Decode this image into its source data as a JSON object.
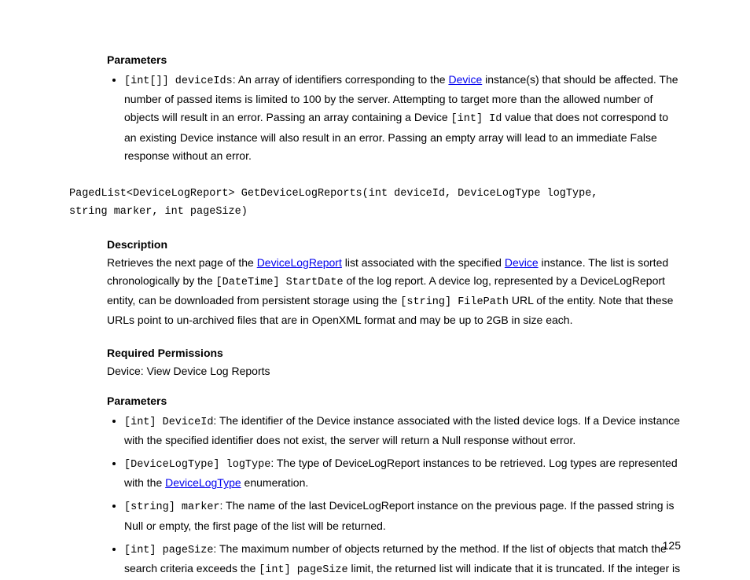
{
  "section1": {
    "heading": "Parameters",
    "bullet1_code": "[int[]] deviceIds",
    "bullet1_pre": ": An array of identifiers corresponding to the ",
    "bullet1_link": "Device",
    "bullet1_post": " instance(s) that should be affected. The number of passed items is limited to 100 by the server. Attempting to target more than the allowed number of objects will result in an error. Passing an array containing a Device ",
    "bullet1_code2": "[int] Id",
    "bullet1_tail": " value that does not correspond to an existing Device instance will also result in an error. Passing an empty array will lead to an immediate False response without an error."
  },
  "signature": {
    "line1": "PagedList<DeviceLogReport> GetDeviceLogReports(int deviceId, DeviceLogType logType,",
    "line2": "string marker, int pageSize)"
  },
  "description": {
    "heading": "Description",
    "t1": "Retrieves the next page of the ",
    "link1": "DeviceLogReport",
    "t2": " list associated with the specified ",
    "link2": "Device",
    "t3": " instance. The list is sorted chronologically by the ",
    "code1": "[DateTime] StartDate",
    "t4": " of the log report. A device log, represented by a DeviceLogReport entity, can be downloaded from persistent storage using the ",
    "code2": "[string] FilePath",
    "t5": " URL of the entity. Note that these URLs point to un-archived files that are in OpenXML format and may be up to 2GB in size each."
  },
  "permissions": {
    "heading": "Required Permissions",
    "text": "Device: View Device Log Reports"
  },
  "params2": {
    "heading": "Parameters",
    "b1_code": "[int] DeviceId",
    "b1_text": ": The identifier of the Device instance associated with the listed device logs. If a Device instance with the specified identifier does not exist, the server will return a Null response without error.",
    "b2_code": "[DeviceLogType] logType",
    "b2_t1": ": The type of DeviceLogReport instances to be retrieved. Log types are represented with the ",
    "b2_link": "DeviceLogType",
    "b2_t2": " enumeration.",
    "b3_code": "[string] marker",
    "b3_text": ": The name of the last DeviceLogReport instance on the previous page. If the passed string is Null or empty, the first page of the list will be returned.",
    "b4_code": "[int] pageSize",
    "b4_t1": ": The maximum number of objects returned by the method. If the list of objects that match the search criteria exceeds the ",
    "b4_code2": "[int] pageSize",
    "b4_t2": " limit, the returned list will indicate that it is truncated. If the integer is"
  },
  "page_number": "125"
}
